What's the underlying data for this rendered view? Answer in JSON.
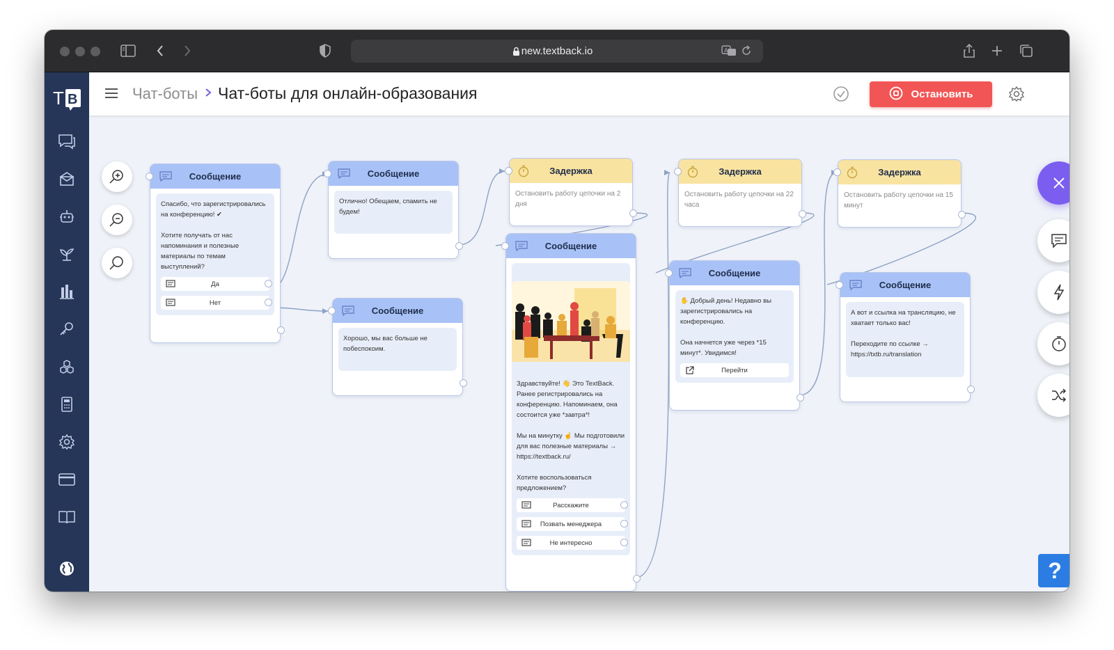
{
  "browser": {
    "url": "new.textback.io"
  },
  "app": {
    "logo_text": "TB"
  },
  "header": {
    "breadcrumb_root": "Чат-боты",
    "title": "Чат-боты для онлайн-образования",
    "stop_label": "Остановить"
  },
  "nodes": {
    "n1": {
      "title": "Сообщение",
      "paragraphs": [
        "Спасибо, что зарегистрировались на конференцию! ✔",
        "Хотите получать от нас напоминания и полезные материалы по темам выступлений?"
      ],
      "buttons": [
        "Да",
        "Нет"
      ]
    },
    "n2": {
      "title": "Сообщение",
      "paragraphs": [
        "Отлично! Обещаем, спамить не будем!"
      ]
    },
    "n3": {
      "title": "Сообщение",
      "paragraphs": [
        "Хорошо, мы вас больше не побеспокоим."
      ]
    },
    "d1": {
      "title": "Задержка",
      "text": "Остановить работу цепочки на 2 дня"
    },
    "n4": {
      "title": "Сообщение",
      "paragraphs": [
        "Здравствуйте! 👋 Это TextBack.\nРанее  регистрировались на конференцию. Напоминаем, она состоится уже *завтра*!",
        "Мы на минутку ☝ Мы подготовили для вас полезные материалы → https://textback.ru/",
        "Хотите воспользоваться предложением?"
      ],
      "buttons": [
        "Расскажите",
        "Позвать менеджера",
        "Не интересно"
      ]
    },
    "d2": {
      "title": "Задержка",
      "text": "Остановить работу цепочки на 22 часа"
    },
    "n5": {
      "title": "Сообщение",
      "paragraphs": [
        "✋ Добрый день! Недавно вы зарегистрировались на конференцию.",
        "Она начнется уже через *15 минут*. Увидимся!"
      ],
      "buttons": [
        "Перейти"
      ]
    },
    "d3": {
      "title": "Задержка",
      "text": "Остановить работу цепочки на 15 минут"
    },
    "n6": {
      "title": "Сообщение",
      "paragraphs": [
        "А вот и ссылка на трансляцию, не хватает только вас!",
        "Переходите по ссылке → https://txtb.ru/translation"
      ]
    }
  },
  "help": {
    "label": "?"
  },
  "colors": {
    "accent": "#7b5ef0",
    "stop": "#f25555",
    "sidebar": "#253659",
    "message_header": "#a8c2f7",
    "delay_header": "#f9e3a1",
    "help": "#2b7de3"
  }
}
